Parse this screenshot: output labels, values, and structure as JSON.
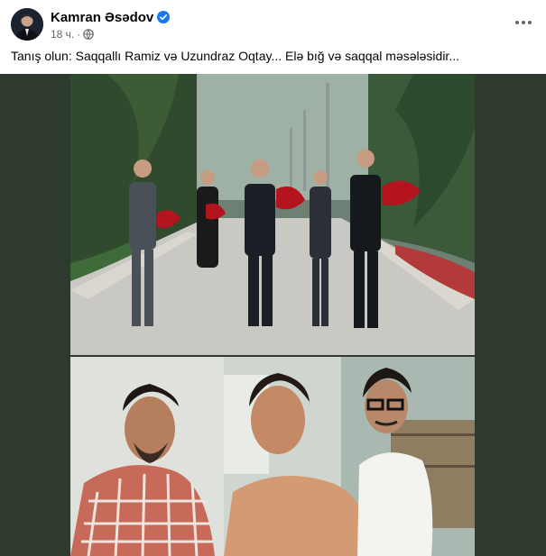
{
  "post": {
    "author_name": "Kamran Əsədov",
    "timestamp": "18 ч.",
    "separator": "·",
    "caption": "Tanış olun: Saqqallı Ramiz və Uzundraz Oqtay... Elə bığ və saqqal məsələsidir..."
  },
  "icons": {
    "verified": "verified-badge-icon",
    "audience": "globe-icon",
    "more": "more-options-icon"
  },
  "colors": {
    "verified_blue": "#1877f2",
    "media_background": "#2e3a2e",
    "meta_gray": "#65676b"
  }
}
